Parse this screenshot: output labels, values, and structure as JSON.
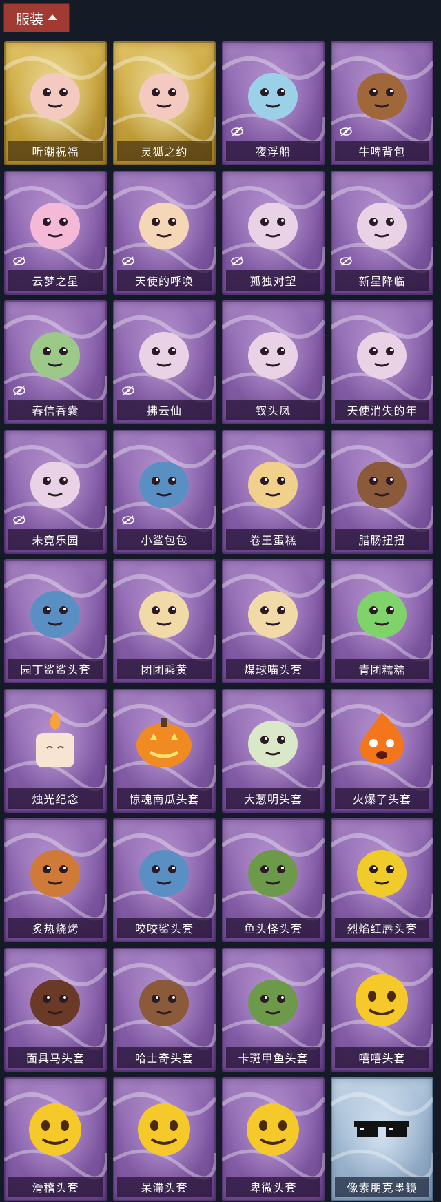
{
  "header": {
    "label": "服装"
  },
  "colors": {
    "header_bg": "#a13a33",
    "card_purple": "#8a63ad",
    "card_gold": "#c9a53e",
    "card_blue": "#9fb8d1"
  },
  "items": [
    {
      "name": "听潮祝福",
      "rarity": "gold",
      "hidden_icon": false,
      "icon": "avatar-icon"
    },
    {
      "name": "灵狐之约",
      "rarity": "gold",
      "hidden_icon": false,
      "icon": "avatar-icon"
    },
    {
      "name": "夜浮船",
      "rarity": "purple",
      "hidden_icon": true,
      "icon": "jellyfish-icon"
    },
    {
      "name": "牛啤背包",
      "rarity": "purple",
      "hidden_icon": true,
      "icon": "barrel-icon"
    },
    {
      "name": "云梦之星",
      "rarity": "purple",
      "hidden_icon": true,
      "icon": "unicorn-icon"
    },
    {
      "name": "天使的呼唤",
      "rarity": "purple",
      "hidden_icon": true,
      "icon": "angel-icon"
    },
    {
      "name": "孤独对望",
      "rarity": "purple",
      "hidden_icon": true,
      "icon": "figure-icon"
    },
    {
      "name": "新星降临",
      "rarity": "purple",
      "hidden_icon": true,
      "icon": "figure-icon"
    },
    {
      "name": "春信香囊",
      "rarity": "purple",
      "hidden_icon": true,
      "icon": "sachet-icon"
    },
    {
      "name": "拂云仙",
      "rarity": "purple",
      "hidden_icon": true,
      "icon": "figure-icon"
    },
    {
      "name": "钗头凤",
      "rarity": "purple",
      "hidden_icon": false,
      "icon": "figure-icon"
    },
    {
      "name": "天使消失的年",
      "rarity": "purple",
      "hidden_icon": false,
      "icon": "figure-icon"
    },
    {
      "name": "未竟乐园",
      "rarity": "purple",
      "hidden_icon": true,
      "icon": "figure-icon"
    },
    {
      "name": "小鲨包包",
      "rarity": "purple",
      "hidden_icon": true,
      "icon": "shark-icon"
    },
    {
      "name": "卷王蛋糕",
      "rarity": "purple",
      "hidden_icon": false,
      "icon": "cake-icon"
    },
    {
      "name": "腊肠扭扭",
      "rarity": "purple",
      "hidden_icon": false,
      "icon": "dog-icon"
    },
    {
      "name": "园丁鲨鲨头套",
      "rarity": "purple",
      "hidden_icon": false,
      "icon": "shark-icon"
    },
    {
      "name": "团团乘黄",
      "rarity": "purple",
      "hidden_icon": false,
      "icon": "cat-icon"
    },
    {
      "name": "煤球喵头套",
      "rarity": "purple",
      "hidden_icon": false,
      "icon": "cat-icon"
    },
    {
      "name": "青团糯糯",
      "rarity": "purple",
      "hidden_icon": false,
      "icon": "blob-icon"
    },
    {
      "name": "烛光纪念",
      "rarity": "purple",
      "hidden_icon": false,
      "icon": "candle-icon"
    },
    {
      "name": "惊魂南瓜头套",
      "rarity": "purple",
      "hidden_icon": false,
      "icon": "pumpkin-icon"
    },
    {
      "name": "大葱明头套",
      "rarity": "purple",
      "hidden_icon": false,
      "icon": "scallion-icon"
    },
    {
      "name": "火爆了头套",
      "rarity": "purple",
      "hidden_icon": false,
      "icon": "fire-icon"
    },
    {
      "name": "炙热烧烤",
      "rarity": "purple",
      "hidden_icon": false,
      "icon": "meat-icon"
    },
    {
      "name": "咬咬鲨头套",
      "rarity": "purple",
      "hidden_icon": false,
      "icon": "shark-icon"
    },
    {
      "name": "鱼头怪头套",
      "rarity": "purple",
      "hidden_icon": false,
      "icon": "fish-icon"
    },
    {
      "name": "烈焰红唇头套",
      "rarity": "purple",
      "hidden_icon": false,
      "icon": "pikachu-icon"
    },
    {
      "name": "面具马头套",
      "rarity": "purple",
      "hidden_icon": false,
      "icon": "horse-icon"
    },
    {
      "name": "哈士奇头套",
      "rarity": "purple",
      "hidden_icon": false,
      "icon": "dog-icon"
    },
    {
      "name": "卡斑甲鱼头套",
      "rarity": "purple",
      "hidden_icon": false,
      "icon": "fish-icon"
    },
    {
      "name": "嘻嘻头套",
      "rarity": "purple",
      "hidden_icon": false,
      "icon": "emoji-icon"
    },
    {
      "name": "滑稽头套",
      "rarity": "purple",
      "hidden_icon": false,
      "icon": "emoji-icon"
    },
    {
      "name": "呆滞头套",
      "rarity": "purple",
      "hidden_icon": false,
      "icon": "emoji-icon"
    },
    {
      "name": "卑微头套",
      "rarity": "purple",
      "hidden_icon": false,
      "icon": "emoji-icon"
    },
    {
      "name": "像素朋克墨镜",
      "rarity": "blue",
      "hidden_icon": false,
      "icon": "sunglasses-icon"
    }
  ]
}
